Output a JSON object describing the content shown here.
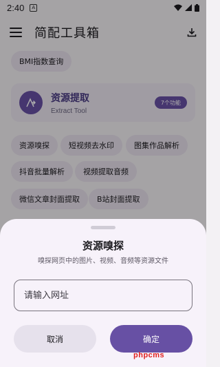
{
  "status_bar": {
    "time": "2:40",
    "notification_icon": "A"
  },
  "app_bar": {
    "title": "简配工具箱",
    "menu_icon": "menu-icon",
    "action_icon": "download-icon"
  },
  "prev_chip": {
    "label": "BMI指数查询"
  },
  "category": {
    "title": "资源提取",
    "subtitle": "Extract Tool",
    "badge": "7个功能",
    "icon": "extract-icon"
  },
  "tools": [
    {
      "label": "资源嗅探"
    },
    {
      "label": "短视频去水印"
    },
    {
      "label": "图集作品解析"
    },
    {
      "label": "抖音批量解析"
    },
    {
      "label": "视频提取音频"
    },
    {
      "label": "微信文章封面提取"
    },
    {
      "label": "B站封面提取"
    }
  ],
  "dialog": {
    "title": "资源嗅探",
    "description": "嗅探网页中的图片、视频、音频等资源文件",
    "input_placeholder": "请输入网址",
    "input_value": "",
    "cancel_label": "取消",
    "confirm_label": "确定"
  },
  "watermark": "phpcms",
  "colors": {
    "primary": "#6750a4",
    "chip_bg": "#e7e0ec",
    "sheet_bg": "#f7f2fa"
  }
}
